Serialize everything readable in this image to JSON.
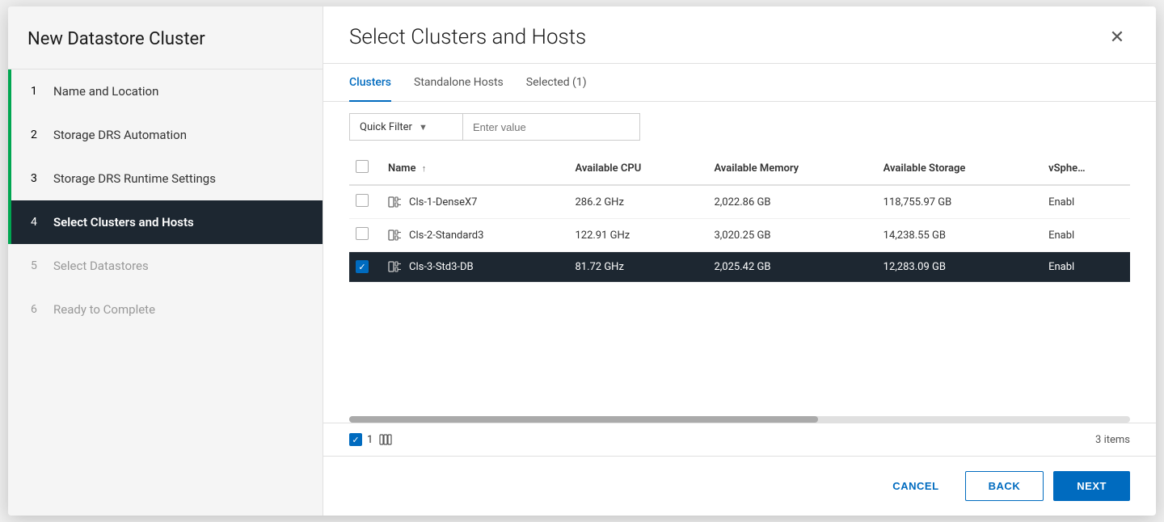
{
  "sidebar": {
    "title": "New Datastore Cluster",
    "steps": [
      {
        "number": "1",
        "label": "Name and Location",
        "state": "completed"
      },
      {
        "number": "2",
        "label": "Storage DRS Automation",
        "state": "completed"
      },
      {
        "number": "3",
        "label": "Storage DRS Runtime Settings",
        "state": "completed"
      },
      {
        "number": "4",
        "label": "Select Clusters and Hosts",
        "state": "active"
      },
      {
        "number": "5",
        "label": "Select Datastores",
        "state": "disabled"
      },
      {
        "number": "6",
        "label": "Ready to Complete",
        "state": "disabled"
      }
    ]
  },
  "main": {
    "title": "Select Clusters and Hosts",
    "tabs": [
      {
        "label": "Clusters",
        "active": true
      },
      {
        "label": "Standalone Hosts",
        "active": false
      },
      {
        "label": "Selected (1)",
        "active": false
      }
    ],
    "filter": {
      "quick_filter_label": "Quick Filter",
      "filter_placeholder": "Enter value"
    },
    "table": {
      "columns": [
        {
          "label": "Name",
          "sortable": true
        },
        {
          "label": "Available CPU",
          "sortable": false
        },
        {
          "label": "Available Memory",
          "sortable": false
        },
        {
          "label": "Available Storage",
          "sortable": false
        },
        {
          "label": "vSphe...",
          "sortable": false
        }
      ],
      "rows": [
        {
          "id": "row1",
          "name": "Cls-1-DenseX7",
          "cpu": "286.2 GHz",
          "memory": "2,022.86 GB",
          "storage": "118,755.97 GB",
          "vsphere": "Enabl",
          "checked": false,
          "selected": false
        },
        {
          "id": "row2",
          "name": "Cls-2-Standard3",
          "cpu": "122.91 GHz",
          "memory": "3,020.25 GB",
          "storage": "14,238.55 GB",
          "vsphere": "Enabl",
          "checked": false,
          "selected": false
        },
        {
          "id": "row3",
          "name": "Cls-3-Std3-DB",
          "cpu": "81.72 GHz",
          "memory": "2,025.42 GB",
          "storage": "12,283.09 GB",
          "vsphere": "Enabl",
          "checked": true,
          "selected": true
        }
      ],
      "total_items": "3 items"
    },
    "footer": {
      "selected_count": "1",
      "items_label": "3 items"
    },
    "buttons": {
      "cancel": "CANCEL",
      "back": "BACK",
      "next": "NEXT"
    }
  }
}
